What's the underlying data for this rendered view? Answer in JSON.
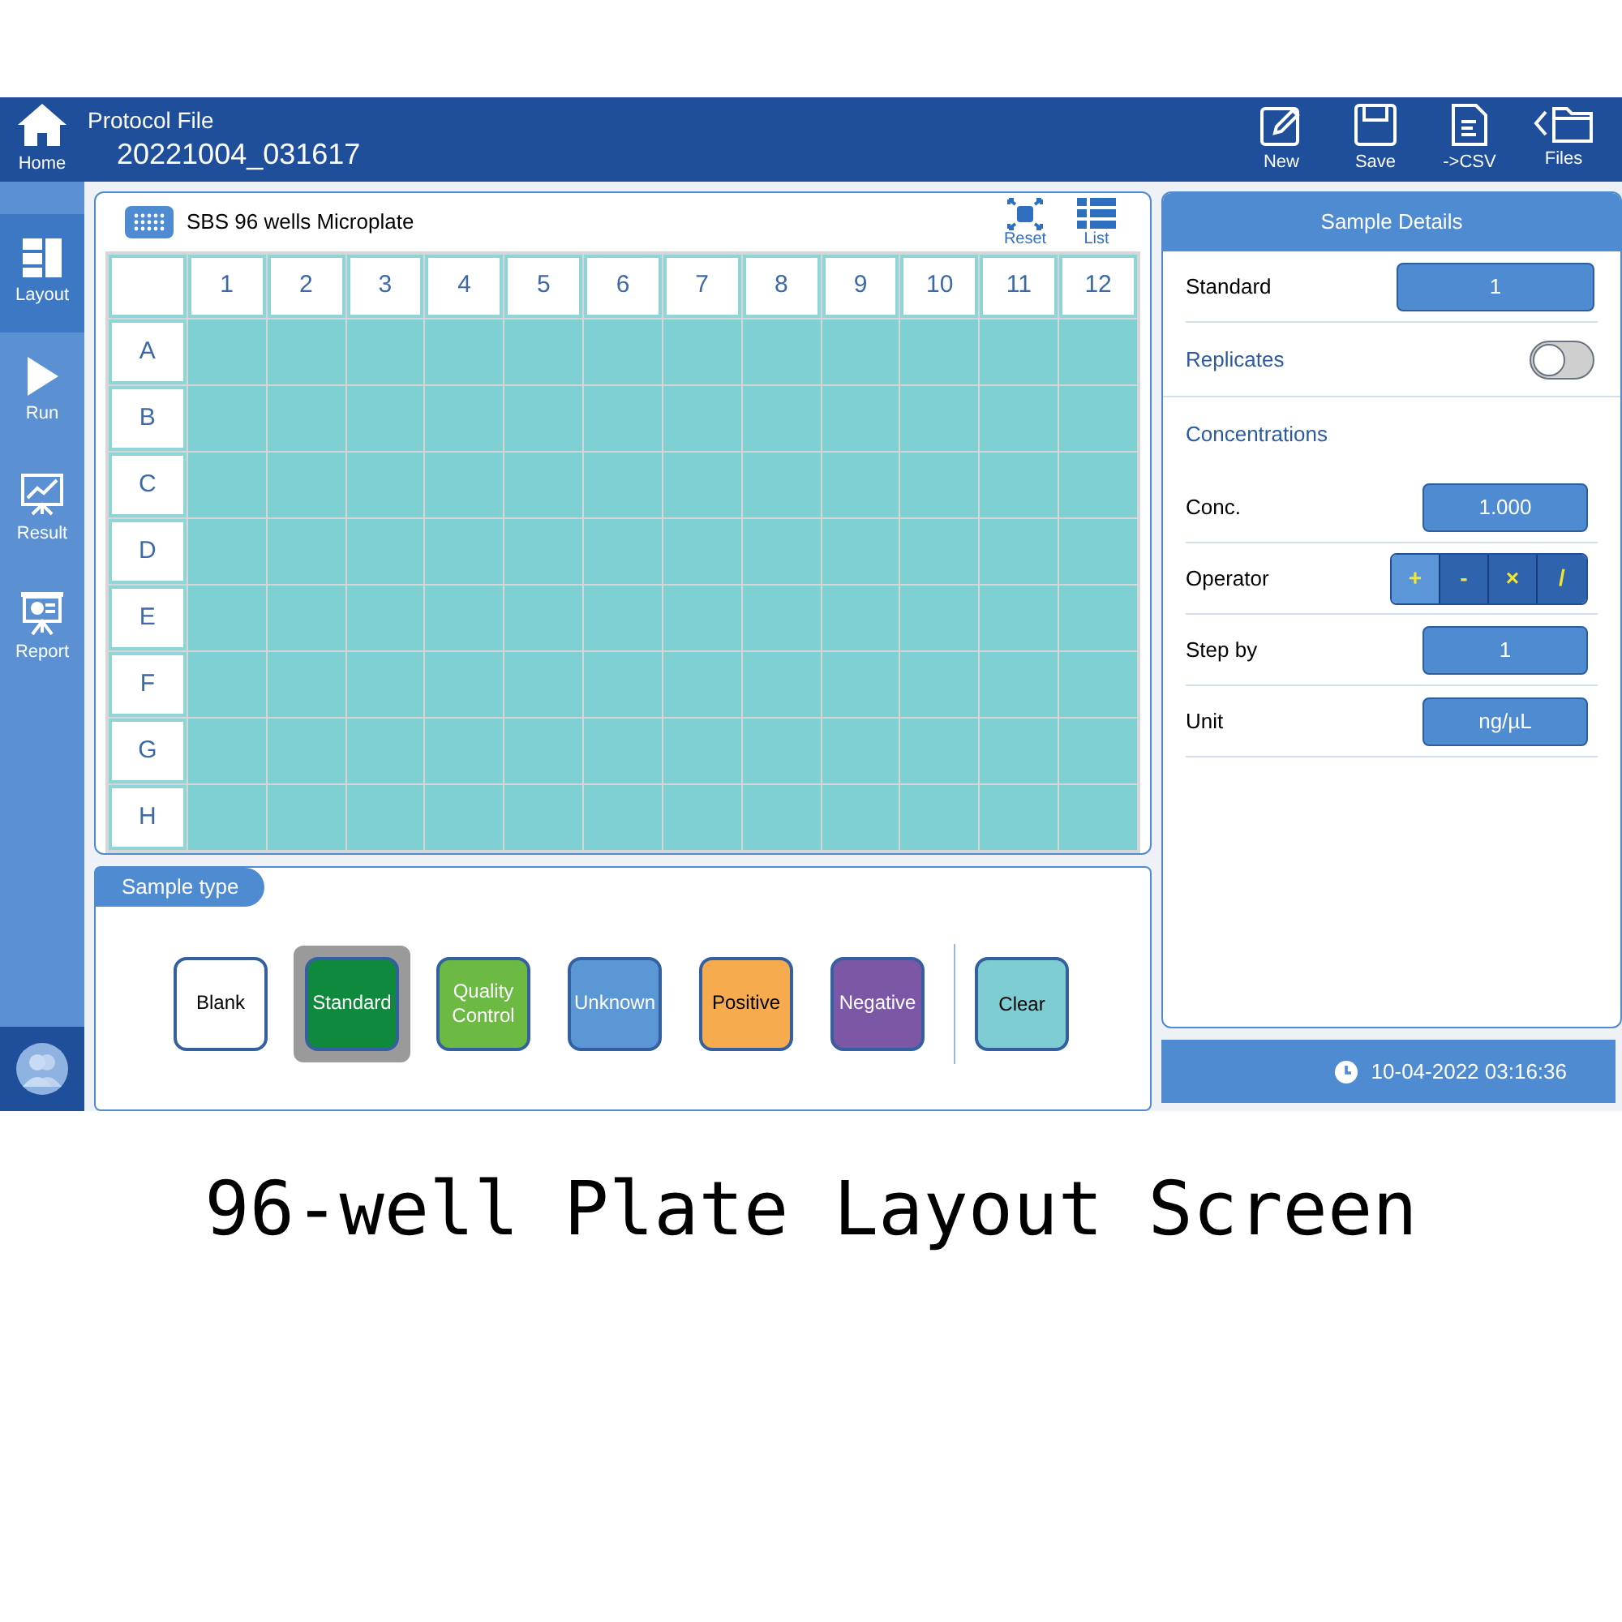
{
  "nav": [
    {
      "label": "Home",
      "selected": false
    },
    {
      "label": "Layout",
      "selected": true
    },
    {
      "label": "Run",
      "selected": false
    },
    {
      "label": "Result",
      "selected": false
    },
    {
      "label": "Report",
      "selected": false
    }
  ],
  "header": {
    "title": "Protocol File",
    "file_name": "20221004_031617"
  },
  "toolbar": [
    {
      "label": "New"
    },
    {
      "label": "Save"
    },
    {
      "label": "->CSV"
    },
    {
      "label": "Files"
    }
  ],
  "plate": {
    "title": "SBS 96 wells Microplate",
    "actions": [
      {
        "label": "Reset"
      },
      {
        "label": "List"
      }
    ],
    "columns": [
      "1",
      "2",
      "3",
      "4",
      "5",
      "6",
      "7",
      "8",
      "9",
      "10",
      "11",
      "12"
    ],
    "rows": [
      "A",
      "B",
      "C",
      "D",
      "E",
      "F",
      "G",
      "H"
    ]
  },
  "sample_type": {
    "title": "Sample type",
    "types": [
      {
        "label": "Blank",
        "color": "#ffffff",
        "selected": false
      },
      {
        "label": "Standard",
        "color": "#0f8a3c",
        "selected": true
      },
      {
        "label": "Quality Control",
        "color": "#6cb944",
        "selected": false
      },
      {
        "label": "Unknown",
        "color": "#5b97d4",
        "selected": false
      },
      {
        "label": "Positive",
        "color": "#f6ab4f",
        "selected": false
      },
      {
        "label": "Negative",
        "color": "#7b57a6",
        "selected": false
      }
    ],
    "clear_button": "Clear"
  },
  "sample_details": {
    "title": "Sample Details",
    "fields": [
      {
        "kind": "value",
        "label": "Standard",
        "value": "1"
      },
      {
        "kind": "toggle",
        "label": "Replicates",
        "on": false
      },
      {
        "kind": "section",
        "label": "Concentrations"
      },
      {
        "kind": "value",
        "label": "Conc.",
        "value": "1.000"
      },
      {
        "kind": "operator",
        "label": "Operator",
        "options": [
          {
            "label": "+",
            "selected": true
          },
          {
            "label": "-",
            "selected": false
          },
          {
            "label": "×",
            "selected": false
          },
          {
            "label": "/",
            "selected": false
          }
        ]
      },
      {
        "kind": "value",
        "label": "Step by",
        "value": "1"
      },
      {
        "kind": "value",
        "label": "Unit",
        "value": "ng/µL"
      }
    ]
  },
  "status_bar": {
    "datetime": "10-04-2022 03:16:36"
  },
  "caption": "96-well Plate Layout Screen"
}
